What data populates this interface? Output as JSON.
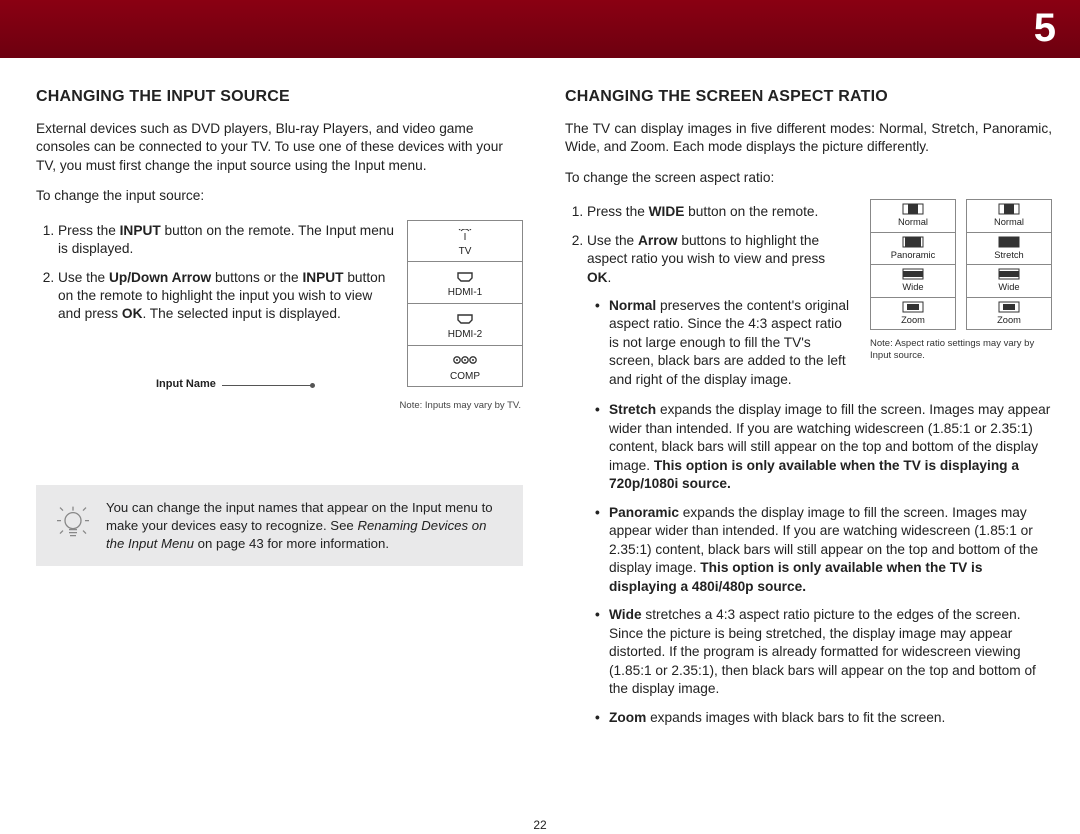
{
  "page_number": "5",
  "footer_page": "22",
  "left": {
    "title": "CHANGING THE INPUT SOURCE",
    "intro": "External devices such as DVD players, Blu-ray Players, and video game consoles can be connected to your TV. To use one of these devices with your TV, you must first change the input source using the Input menu.",
    "lead": "To change the input source:",
    "step1_a": "Press the ",
    "step1_b": "INPUT",
    "step1_c": " button on the remote. The Input menu is displayed.",
    "step2_a": "Use the ",
    "step2_b": "Up/Down Arrow",
    "step2_c": " buttons or the ",
    "step2_d": "INPUT",
    "step2_e": " button on the remote to highlight the input you wish to view and press ",
    "step2_f": "OK",
    "step2_g": ". The selected input is displayed.",
    "menu_items": {
      "tv": "TV",
      "hdmi1": "HDMI-1",
      "hdmi2": "HDMI-2",
      "comp": "COMP"
    },
    "input_name_label": "Input Name",
    "note": "Note: Inputs may vary by TV.",
    "tip_a": "You can change the input names that appear on the Input menu to make your devices easy to recognize. See ",
    "tip_b": "Renaming Devices on the Input Menu",
    "tip_c": " on page 43 for more information."
  },
  "right": {
    "title": "CHANGING THE SCREEN ASPECT RATIO",
    "intro": "The TV can display images in five different modes: Normal, Stretch, Panoramic, Wide, and Zoom. Each mode displays the picture differently.",
    "lead": "To change the screen aspect ratio:",
    "step1_a": "Press the ",
    "step1_b": "WIDE",
    "step1_c": " button on the remote.",
    "step2_a": "Use the ",
    "step2_b": "Arrow",
    "step2_c": " buttons to highlight the aspect ratio you wish to view and press ",
    "step2_d": "OK",
    "step2_e": ".",
    "bullets": {
      "normal_a": "Normal ",
      "normal_b": "preserves the content's original aspect ratio. Since the 4:3 aspect ratio is not large enough to fill the TV's screen, black bars are added to the left and right of the display image.",
      "stretch_a": "Stretch ",
      "stretch_b": "expands the display image to fill the screen. Images may appear wider than intended. If you are watching widescreen (1.85:1 or 2.35:1) content, black bars will still appear on the top and bottom of the display image. ",
      "stretch_c": "This option is only available when the TV is displaying a 720p/1080i source.",
      "panoramic_a": "Panoramic ",
      "panoramic_b": "expands the display image to fill the screen. Images may appear wider than intended. If you are watching widescreen (1.85:1 or 2.35:1) content, black bars will still appear on the top and bottom of the display image. ",
      "panoramic_c": "This option is only available when the TV is displaying a 480i/480p source.",
      "wide_a": "Wide ",
      "wide_b": "stretches a 4:3 aspect ratio picture to the edges of the screen. Since the picture is being stretched, the display image may appear distorted. If the program is already formatted for widescreen viewing (1.85:1 or 2.35:1), then black bars will appear on the top and bottom of the display image.",
      "zoom_a": "Zoom ",
      "zoom_b": "expands images with black bars to fit the screen."
    },
    "aspect_cols": {
      "col1": {
        "r1": "Normal",
        "r2": "Panoramic",
        "r3": "Wide",
        "r4": "Zoom"
      },
      "col2": {
        "r1": "Normal",
        "r2": "Stretch",
        "r3": "Wide",
        "r4": "Zoom"
      }
    },
    "note": "Note: Aspect ratio settings may vary by Input source."
  }
}
